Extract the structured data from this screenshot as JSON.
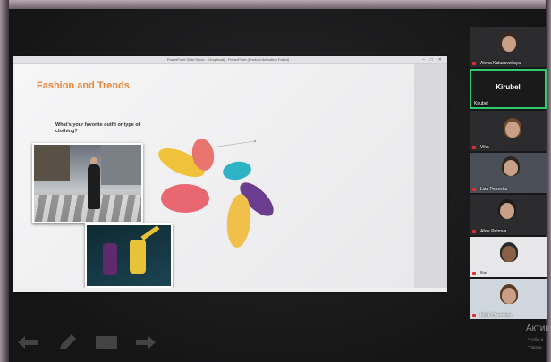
{
  "window": {
    "title": "PowerPoint Slide Show - [Graphical] - PowerPoint (Product Activation Failed)",
    "controls": [
      "–",
      "□",
      "✕"
    ]
  },
  "slide": {
    "title": "Fashion and Trends",
    "question": "What's your favorite outfit or type of clothing?",
    "petal_colors": [
      "#f0c23b",
      "#e8766f",
      "#f1c04b",
      "#2db3c3",
      "#6a3d8f",
      "#e86770",
      "#f2c43f"
    ]
  },
  "participants": [
    {
      "name": "Alena Kalusovskaya",
      "muted": true
    },
    {
      "name": "Kirubel",
      "display_name": "Kirubel",
      "active": true
    },
    {
      "name": "Vika",
      "muted": true
    },
    {
      "name": "Liza Popeska",
      "muted": true
    },
    {
      "name": "Alice Petrova",
      "muted": true
    },
    {
      "name": "Nat...",
      "muted": true
    },
    {
      "name": "Mark Chernikov",
      "muted": true
    }
  ],
  "toolbar": {
    "icons": [
      "arrow-left-icon",
      "pen-icon",
      "keyboard-icon",
      "arrow-right-icon"
    ]
  },
  "activation": {
    "title": "Актив",
    "line1": "Чтобы а",
    "line2": "\"Парам"
  },
  "colors": {
    "accent_title": "#e8863a",
    "active_speaker_border": "#2ecc71",
    "muted_mic": "#e0302d"
  }
}
